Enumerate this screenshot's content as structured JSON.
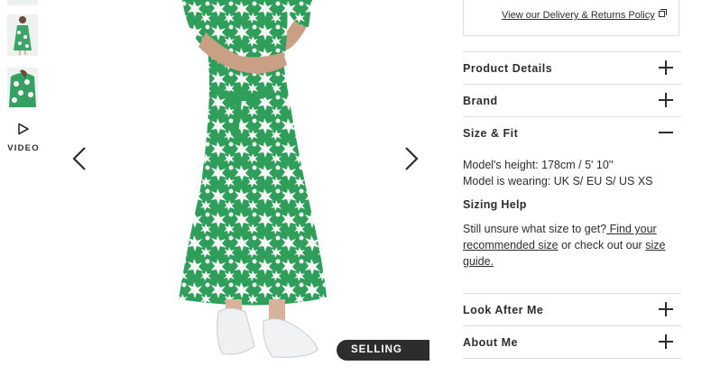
{
  "thumbnails": {
    "video_label": "VIDEO",
    "video_icon": "play-icon"
  },
  "gallery": {
    "prev_icon": "chevron-left-icon",
    "next_icon": "chevron-right-icon",
    "badge": "SELLING FAST",
    "dress_color": "#2f9e5b"
  },
  "delivery": {
    "link_label": "View our Delivery & Returns Policy",
    "link_icon": "external-link-icon"
  },
  "accordion": {
    "product_details": "Product Details",
    "brand": "Brand",
    "size_fit": "Size & Fit",
    "look_after_me": "Look After Me",
    "about_me": "About Me"
  },
  "size_fit": {
    "model_height": "Model's height: 178cm / 5' 10''",
    "model_wearing": "Model is wearing: UK S/ EU S/ US XS",
    "sizing_help_title": "Sizing Help",
    "help_prefix": "Still unsure what size to get?",
    "help_link1": " Find your recommended size",
    "help_middle": " or check out our ",
    "help_link2": "size guide."
  }
}
